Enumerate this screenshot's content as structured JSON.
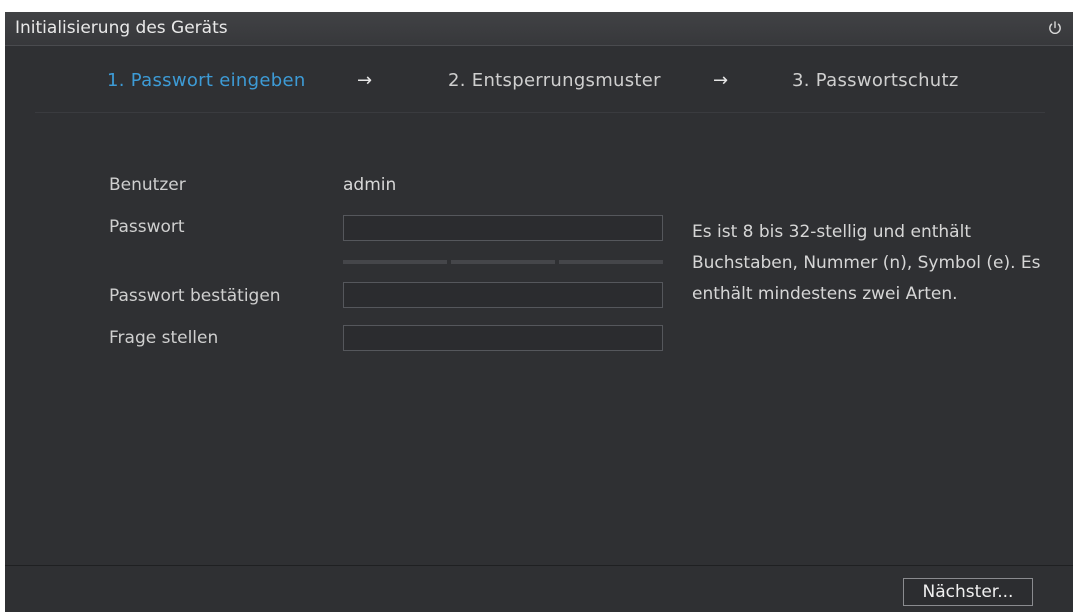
{
  "window": {
    "title": "Initialisierung des Geräts"
  },
  "steps": [
    {
      "label": "1.  Passwort eingeben",
      "active": true
    },
    {
      "label": "2.  Entsperrungsmuster",
      "active": false
    },
    {
      "label": "3.  Passwortschutz",
      "active": false
    }
  ],
  "arrow": "→",
  "form": {
    "user_label": "Benutzer",
    "user_value": "admin",
    "password_label": "Passwort",
    "password_value": "",
    "confirm_label": "Passwort bestätigen",
    "confirm_value": "",
    "question_label": "Frage stellen",
    "question_value": ""
  },
  "hint": "Es ist 8 bis 32-stellig und enthält Buchstaben, Nummer (n), Symbol (e). Es enthält mindestens zwei Arten.",
  "footer": {
    "next_label": "Nächster..."
  },
  "icons": {
    "power": "power-icon"
  },
  "colors": {
    "accent": "#3d9bd6",
    "background": "#2f3033",
    "text": "#cfcfcf"
  }
}
